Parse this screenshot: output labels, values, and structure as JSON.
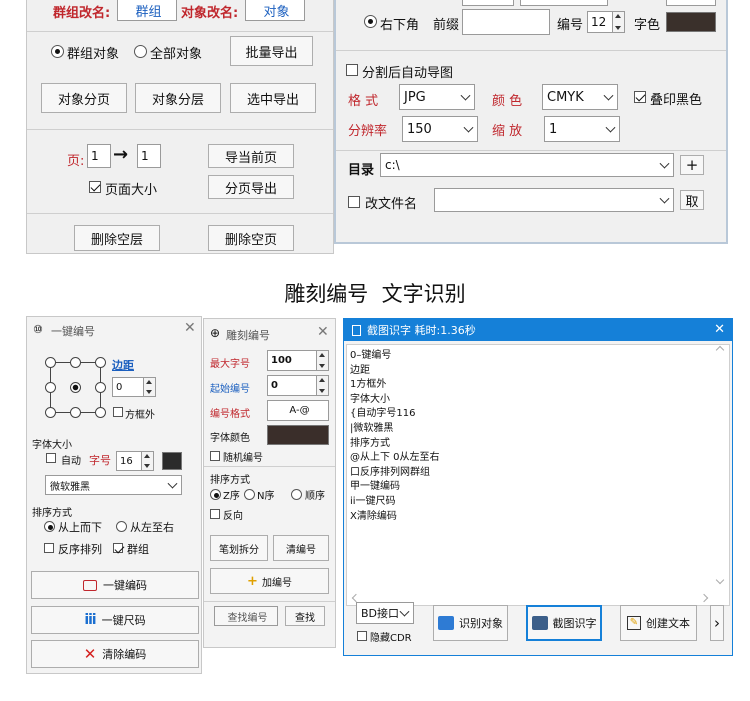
{
  "top_left_panel": {
    "group_rename_label": "群组改名:",
    "group_rename_value": "群组",
    "object_rename_label": "对象改名:",
    "object_rename_value": "对象",
    "radio_group_objects": "群组对象",
    "radio_all_objects": "全部对象",
    "batch_export": "批量导出",
    "object_paging": "对象分页",
    "object_layering": "对象分层",
    "selection_export": "选中导出",
    "page_label": "页:",
    "page_from": "1",
    "page_to": "1",
    "export_current_page": "导当前页",
    "page_size_label": "页面大小",
    "paged_export": "分页导出",
    "delete_empty_layers": "删除空层",
    "delete_empty_pages": "删除空页"
  },
  "top_right_panel": {
    "corner_label": "右下角",
    "prefix_label": "前缀",
    "number_label": "编号",
    "number_value": "12",
    "font_color_label": "字色",
    "font_color": "#3a302b",
    "auto_export_label": "分割后自动导图",
    "format_label": "格 式",
    "format_value": "JPG",
    "color_label": "颜 色",
    "color_value": "CMYK",
    "overprint_label": "叠印黑色",
    "resolution_label": "分辨率",
    "resolution_value": "150",
    "zoom_label": "缩 放",
    "zoom_value": "1",
    "directory_label": "目录",
    "directory_value": "c:\\",
    "add_button": "+",
    "rename_file_label": "改文件名",
    "take_button": "取"
  },
  "section_title": "雕刻编号  文字识别",
  "panel_one_key": {
    "title": "一键编号",
    "margin_label": "边距",
    "margin_value": "0",
    "outside_box_label": "方框外",
    "font_size_section": "字体大小",
    "auto_label": "自动",
    "font_size_label": "字号",
    "font_size_value": "16",
    "font_swatch": "#2b2b2b",
    "font_name": "微软雅黑",
    "sort_section": "排序方式",
    "top_down": "从上而下",
    "left_right": "从左至右",
    "reverse_sort": "反序排列",
    "group": "群组",
    "one_key_number": "一键编码",
    "one_key_ruler": "一键尺码",
    "clear_number": "清除编码"
  },
  "panel_engrave": {
    "title": "雕刻编号",
    "max_label": "最大字号",
    "max_value": "100",
    "start_label": "起始编号",
    "start_value": "0",
    "format_label": "编号格式",
    "format_value": "A-@",
    "color_label": "字体颜色",
    "color_swatch": "#3a2e2a",
    "random_label": "随机编号",
    "sort_section": "排序方式",
    "z_order": "Z序",
    "n_order": "N序",
    "seq_order": "顺序",
    "reverse": "反向",
    "stroke_split": "笔划拆分",
    "clear_number": "清编号",
    "add_number": "加编号",
    "find_number_placeholder": "查找编号",
    "find": "查找"
  },
  "panel_ocr": {
    "title": "截图识字 耗时:1.36秒",
    "text_lines": [
      "0–键编号",
      "边距",
      "1方框外",
      "字体大小",
      "{自动字号116",
      "|微软雅黑",
      "排序方式",
      "@从上下 0从左至右",
      "口反序排列网群组",
      "甲一键编码",
      "ii一键尺码",
      "X清除编码"
    ],
    "interface_value": "BD接口",
    "hide_cdr": "隐藏CDR",
    "recognize_object": "识别对象",
    "screenshot_ocr": "截图识字",
    "create_text": "创建文本",
    "more": "›",
    "accent": "#1580d8"
  }
}
